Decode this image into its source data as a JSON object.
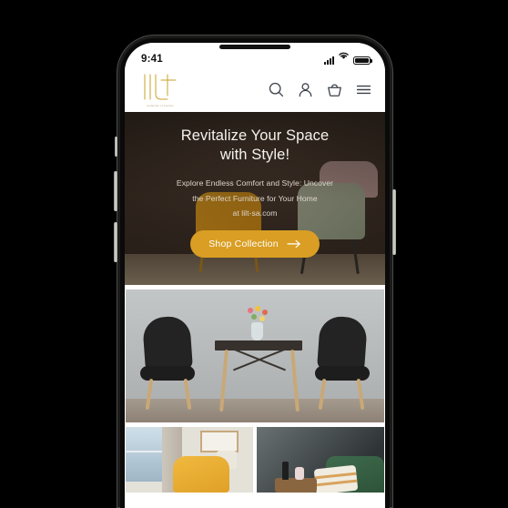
{
  "device": {
    "name": "smartphone-mockup",
    "side_buttons": [
      "silent-switch",
      "volume-up",
      "volume-down",
      "power"
    ]
  },
  "status_bar": {
    "time": "9:41",
    "icons": [
      "cellular-signal-icon",
      "wifi-icon",
      "battery-icon"
    ]
  },
  "header": {
    "logo_text": "lilt",
    "logo_tagline": "Collection of Comfort",
    "actions": [
      {
        "name": "search-icon",
        "label": "Search"
      },
      {
        "name": "account-icon",
        "label": "Account"
      },
      {
        "name": "cart-icon",
        "label": "Cart"
      },
      {
        "name": "menu-icon",
        "label": "Menu"
      }
    ]
  },
  "hero": {
    "title_line1": "Revitalize Your Space",
    "title_line2": "with Style!",
    "subtitle_line1": "Explore Endless Comfort and Style: Uncover",
    "subtitle_line2": "the Perfect Furniture for Your Home",
    "subtitle_line3": "at lilt-sa.com",
    "cta_label": "Shop Collection",
    "cta_icon": "arrow-right-icon"
  },
  "gallery": {
    "featured": {
      "name": "dining-set-photo",
      "alt": "Dining table with two black chairs and flower vase"
    },
    "cards": [
      {
        "name": "armchair-photo",
        "alt": "Yellow armchair by window with table lamp"
      },
      {
        "name": "sofa-photo",
        "alt": "Green sofa with striped pillow against dark wall"
      }
    ]
  },
  "colors": {
    "brand_gold": "#c9a227",
    "cta_amber": "#d99e23",
    "hero_dark": "#2a211c",
    "page_white": "#ffffff"
  }
}
